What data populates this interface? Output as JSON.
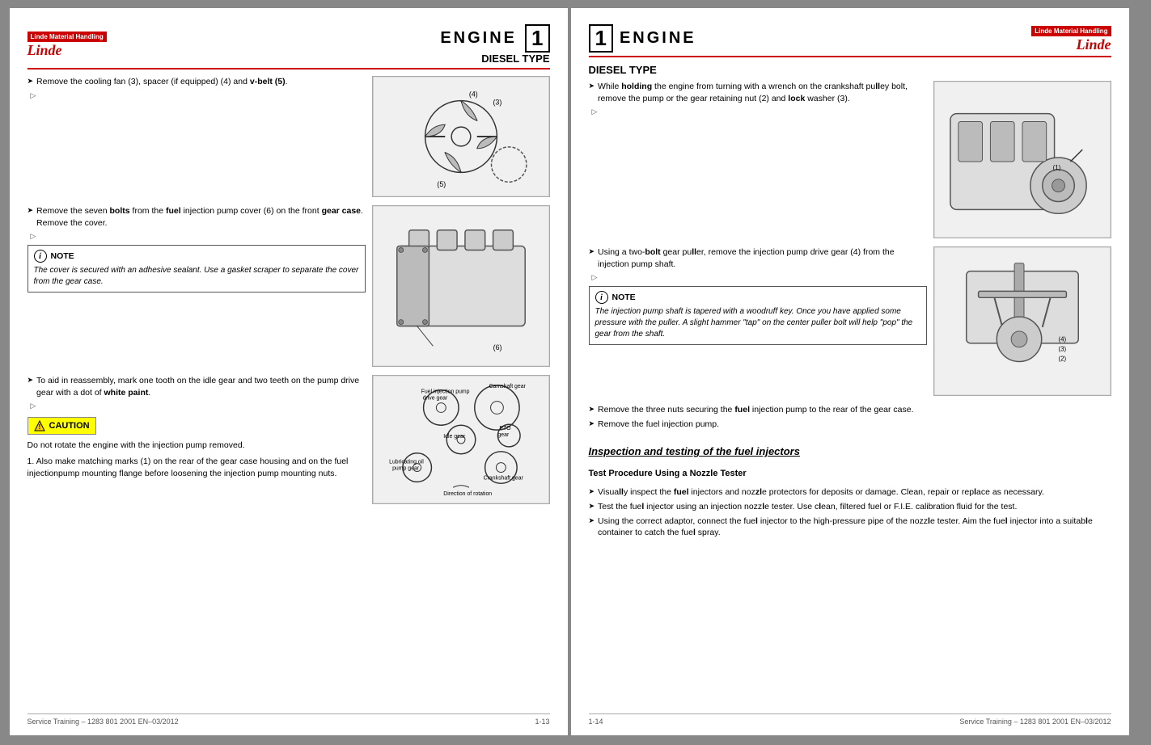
{
  "left_page": {
    "logo_company": "Linde Material Handling",
    "logo_brand": "Linde",
    "engine_label": "ENGINE",
    "engine_number": "1",
    "diesel_type": "DIESEL TYPE",
    "instructions": [
      {
        "id": "inst1",
        "text": "Remove the cooling fan (3), spacer (if equipped) (4) and v-belt (5).",
        "has_arrow": true
      },
      {
        "id": "inst2",
        "text": "Remove the seven bolts from the fuel injection pump cover (6) on the front gear case. Remove the cover.",
        "has_arrow": true
      }
    ],
    "note1": {
      "label": "NOTE",
      "text": "The cover is secured with an adhesive sealant. Use a gasket scraper to separate the cover from the gear case."
    },
    "inst3": {
      "text": "To aid in reassembly, mark one tooth on the idle gear and two teeth on the pump drive gear with a dot of white paint.",
      "has_arrow": true
    },
    "caution": {
      "label": "CAUTION",
      "text": "Do not rotate the engine with the injection pump removed."
    },
    "numbered_item": "1. Also make matching marks (1) on the rear of the gear case housing and on the fuel injectionpump mounting flange before loosening the injection pump mounting nuts.",
    "footer_left": "Service Training – 1283 801 2001 EN–03/2012",
    "footer_right": "1-13"
  },
  "right_page": {
    "engine_number": "1",
    "engine_label": "ENGINE",
    "logo_company": "Linde Material Handling",
    "logo_brand": "Linde",
    "diesel_type": "DIESEL TYPE",
    "instructions": [
      {
        "id": "r_inst1",
        "text": "While holding the engine from turning with a wrench on the crankshaft pulley bolt, remove the pump or the gear retaining nut (2) and lock washer (3).",
        "has_arrow": true
      },
      {
        "id": "r_inst2",
        "text": "Using a two-bolt gear puller, remove the injection pump drive gear (4) from the injection pump shaft.",
        "has_arrow": true
      }
    ],
    "note1": {
      "label": "NOTE",
      "text": "The injection pump shaft is tapered with a woodruff key. Once you have applied some pressure with the puller. A slight hammer \"tap\" on the center puller bolt will help \"pop\" the gear from the shaft."
    },
    "inst_last": [
      {
        "text": "Remove the three nuts securing the fuel injection pump to the rear of the gear case.",
        "has_arrow": true
      },
      {
        "text": "Remove the fuel injection pump.",
        "has_arrow": true
      }
    ],
    "section_heading": "Inspection and testing of the fuel injectors",
    "subsection_heading": "Test Procedure Using a Nozzle Tester",
    "test_instructions": [
      {
        "text": "Visually inspect the fuel injectors and nozzle protectors for deposits or damage. Clean, repair or replace as necessary.",
        "has_arrow": true
      },
      {
        "text": "Test the fuel injector using an injection nozzle tester. Use clean, filtered fuel or F.I.E. calibration fluid for the test.",
        "has_arrow": true
      },
      {
        "text": "Using the correct adaptor, connect the fuel injector to the high-pressure pipe of the nozzle tester. Aim the fuel injector into a suitable container to catch the fuel spray.",
        "has_arrow": true
      }
    ],
    "footer_left": "1-14",
    "footer_right": "Service Training – 1283 801 2001 EN–03/2012"
  }
}
